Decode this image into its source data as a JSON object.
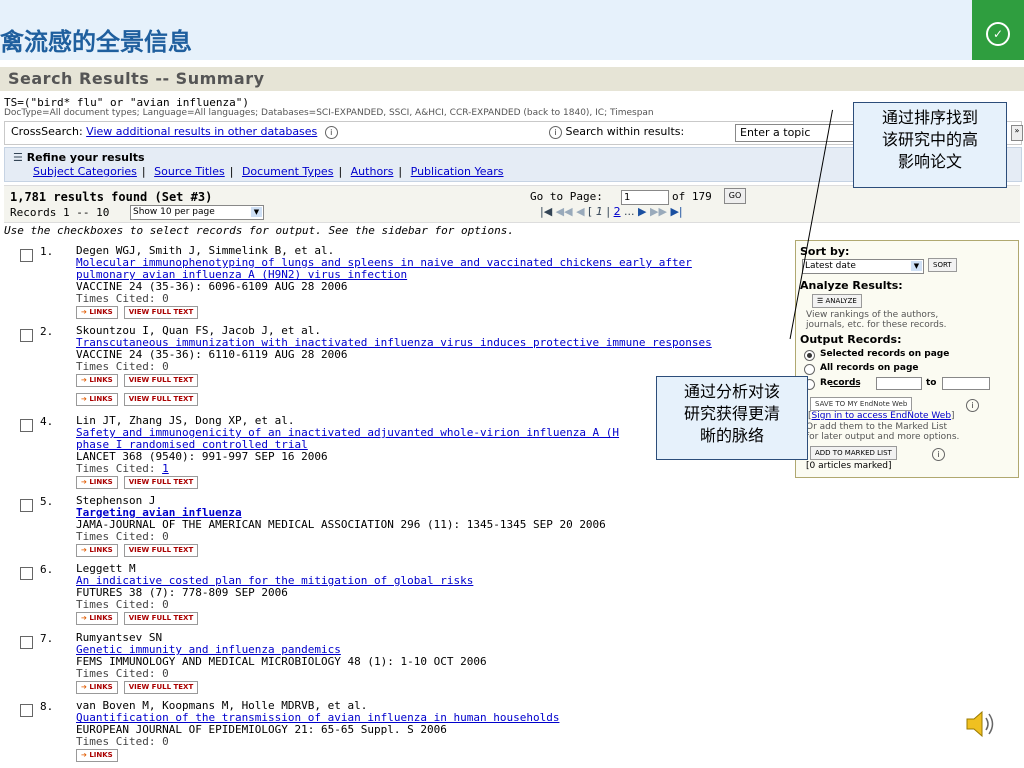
{
  "slide": {
    "title": "禽流感的全景信息"
  },
  "header": {
    "title": "Search Results -- Summary",
    "ts": "TS=(\"bird* flu\" or \"avian influenza\")",
    "doctype": "DocType=All document types; Language=All languages; Databases=SCI-EXPANDED, SSCI, A&HCI, CCR-EXPANDED (back to 1840), IC; Timespan"
  },
  "crosssearch": {
    "label": "CrossSearch:",
    "link": "View additional results in other databases",
    "within": "Search within results:",
    "placeholder": "Enter a topic"
  },
  "refine": {
    "head": "Refine your results",
    "links": [
      "Subject Categories",
      "Source Titles",
      "Document Types",
      "Authors",
      "Publication Years"
    ]
  },
  "results": {
    "found": "1,781 results found (Set #3)",
    "records": "Records 1 -- 10",
    "per_page": "Show 10 per page",
    "goto_label": "Go to Page:",
    "page_value": "1",
    "of_pages": "of 179",
    "go": "GO",
    "current_page": "1",
    "next_page": "2",
    "instruction": "Use the checkboxes to select records for output. See the sidebar for options."
  },
  "records": [
    {
      "num": "1.",
      "authors": "Degen WGJ, Smith J, Simmelink B, et al.",
      "title1": "Molecular immunophenotyping of lungs and spleens in naive and vaccinated chickens early after",
      "title2": "pulmonary avian influenza A (H9N2) virus infection",
      "source": "VACCINE 24 (35-36): 6096-6109 AUG 28 2006",
      "cited": "Times Cited: 0"
    },
    {
      "num": "2.",
      "authors": "Skountzou I, Quan FS, Jacob J, et al.",
      "title1": "Transcutaneous immunization with inactivated influenza virus induces protective immune responses",
      "title2": "",
      "source": "VACCINE 24 (35-36): 6110-6119 AUG 28 2006",
      "cited": "Times Cited: 0"
    },
    {
      "num": "4.",
      "authors": "Lin JT, Zhang JS, Dong XP, et al.",
      "title1": "Safety and immunogenicity of an inactivated adjuvanted whole-virion influenza A (H",
      "title2": "phase I randomised controlled trial",
      "source": "LANCET 368 (9540): 991-997 SEP 16 2006",
      "cited": "Times Cited: 1"
    },
    {
      "num": "5.",
      "authors": "Stephenson J",
      "title1": "Targeting avian influenza",
      "title2": "",
      "source": "JAMA-JOURNAL OF THE AMERICAN MEDICAL ASSOCIATION 296 (11): 1345-1345 SEP 20 2006",
      "cited": "Times Cited: 0"
    },
    {
      "num": "6.",
      "authors": "Leggett M",
      "title1": "An indicative costed plan for the mitigation of global risks",
      "title2": "",
      "source": "FUTURES 38 (7): 778-809 SEP 2006",
      "cited": "Times Cited: 0"
    },
    {
      "num": "7.",
      "authors": "Rumyantsev SN",
      "title1": "Genetic immunity and influenza pandemics",
      "title2": "",
      "source": "FEMS IMMUNOLOGY AND MEDICAL MICROBIOLOGY 48 (1): 1-10 OCT 2006",
      "cited": "Times Cited: 0"
    },
    {
      "num": "8.",
      "authors": "van Boven M, Koopmans M, Holle MDRVB, et al.",
      "title1": "Quantification of the transmission of avian influenza in human households",
      "title2": "",
      "source": "EUROPEAN JOURNAL OF EPIDEMIOLOGY 21: 65-65 Suppl. S 2006",
      "cited": "Times Cited: 0"
    }
  ],
  "buttons": {
    "links": "LINKS",
    "fulltext": "VIEW FULL TEXT"
  },
  "sidebar": {
    "sort_by": "Sort by:",
    "sort_value": "Latest date",
    "sort_btn": "SORT",
    "analyze_head": "Analyze Results:",
    "analyze_btn": "ANALYZE",
    "analyze_desc1": "View rankings of the authors,",
    "analyze_desc2": "journals, etc. for these records.",
    "output_head": "Output Records:",
    "opt1": "Selected records on page",
    "opt2": "All records on page",
    "opt3": "Records",
    "opt3_to": "to",
    "save_btn": "SAVE TO MY EndNote Web",
    "signin": "Sign in to access EndNote Web",
    "marked1": "Or add them to the Marked List",
    "marked2": "for later output and more options.",
    "add_btn": "ADD TO MARKED LIST",
    "marked_count": "[0 articles marked]"
  },
  "callouts": {
    "sort": [
      "通过排序找到",
      "该研究中的高",
      "影响论文"
    ],
    "analyze": [
      "通过分析对该",
      "研究获得更清",
      "晰的脉络"
    ]
  }
}
